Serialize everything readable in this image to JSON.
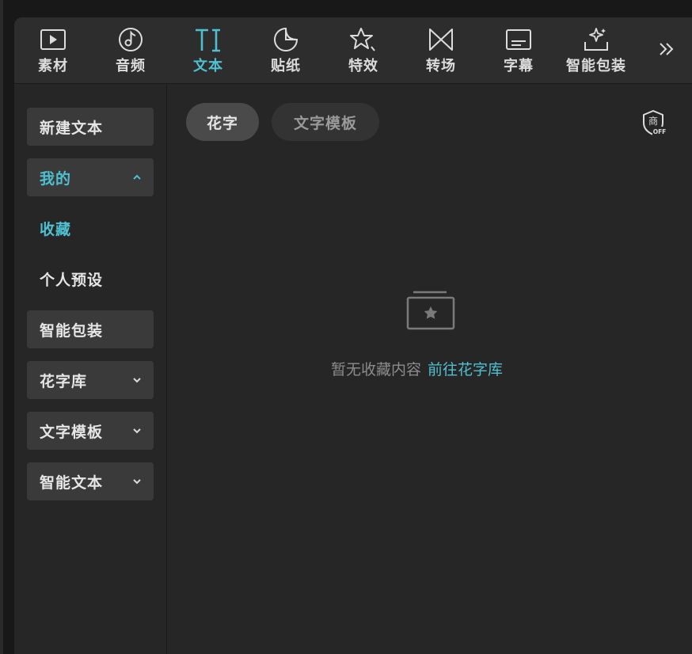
{
  "toolbar": {
    "tabs": [
      {
        "label": "素材",
        "icon": "video-play-icon"
      },
      {
        "label": "音频",
        "icon": "music-note-icon"
      },
      {
        "label": "文本",
        "icon": "text-ti-icon",
        "active": true
      },
      {
        "label": "贴纸",
        "icon": "sticker-icon"
      },
      {
        "label": "特效",
        "icon": "sparkle-star-icon"
      },
      {
        "label": "转场",
        "icon": "transition-bowtie-icon"
      },
      {
        "label": "字幕",
        "icon": "subtitle-icon"
      },
      {
        "label": "智能包装",
        "icon": "smart-pack-icon"
      }
    ],
    "more_icon": "double-chevron-right-icon"
  },
  "sidebar": {
    "new_text": "新建文本",
    "mine": "我的",
    "favorites": "收藏",
    "personal_presets": "个人预设",
    "smart_pack": "智能包装",
    "flower_lib": "花字库",
    "text_templates": "文字模板",
    "smart_text": "智能文本"
  },
  "content": {
    "pill_flower": "花字",
    "pill_templates": "文字模板",
    "shop_badge_top": "商",
    "shop_badge_bottom": "OFF",
    "empty_message": "暂无收藏内容",
    "empty_link": "前往花字库"
  },
  "colors": {
    "accent": "#4fc0d0",
    "panel": "#262626",
    "topbar": "#2d2d2d",
    "item_bg": "#3a3a3a"
  }
}
